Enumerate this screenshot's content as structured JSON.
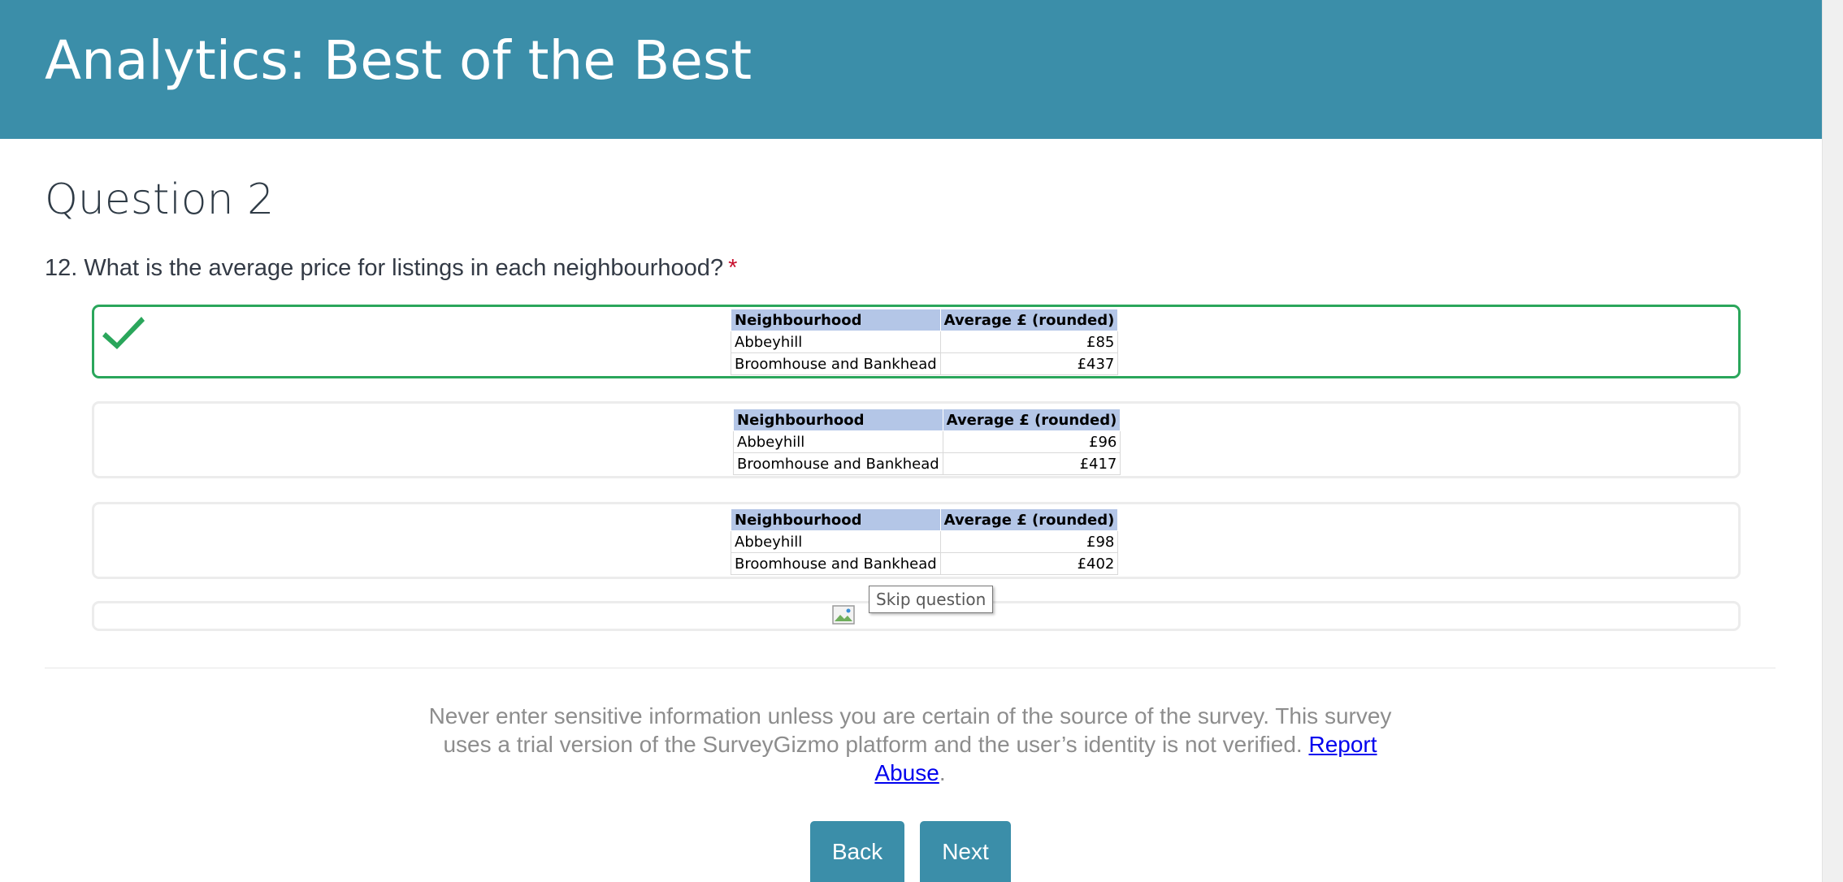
{
  "header": {
    "title": "Analytics: Best of the Best",
    "background_color": "#3b8ea9"
  },
  "page_title": "Question 2",
  "question": {
    "text": "12. What is the average price for listings in each neighbourhood?",
    "required_marker": "*"
  },
  "options": [
    {
      "selected": true,
      "table": {
        "headers": [
          "Neighbourhood",
          "Average £ (rounded)"
        ],
        "rows": [
          [
            "Abbeyhill",
            "£85"
          ],
          [
            "Broomhouse and Bankhead",
            "£437"
          ]
        ]
      }
    },
    {
      "selected": false,
      "table": {
        "headers": [
          "Neighbourhood",
          "Average £ (rounded)"
        ],
        "rows": [
          [
            "Abbeyhill",
            "£96"
          ],
          [
            "Broomhouse and Bankhead",
            "£417"
          ]
        ]
      }
    },
    {
      "selected": false,
      "table": {
        "headers": [
          "Neighbourhood",
          "Average £ (rounded)"
        ],
        "rows": [
          [
            "Abbeyhill",
            "£98"
          ],
          [
            "Broomhouse and Bankhead",
            "£402"
          ]
        ]
      }
    },
    {
      "selected": false,
      "image": "broken-image-icon"
    }
  ],
  "tooltip": "Skip question",
  "notice": {
    "text": "Never enter sensitive information unless you are certain of the source of the survey. This survey uses a trial version of the SurveyGizmo platform and the user’s identity is not verified.",
    "link_text": "Report Abuse",
    "trailing": "."
  },
  "buttons": {
    "back": "Back",
    "next": "Next"
  },
  "colors": {
    "accent": "#3b8ea9",
    "selected_border": "#2aa65b",
    "required": "#c8102e",
    "table_header": "#b4c6e7"
  }
}
